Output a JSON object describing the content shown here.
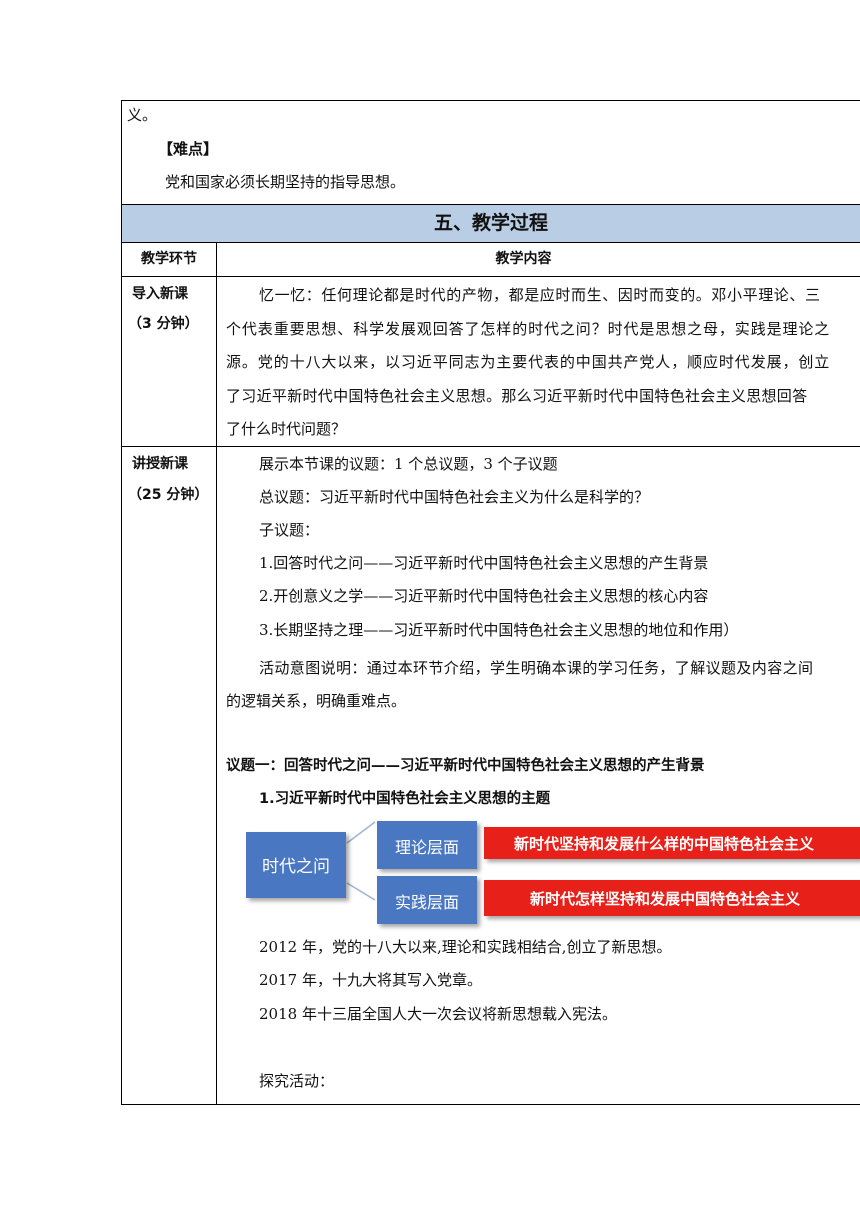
{
  "top": {
    "line1": "义。",
    "difficulty_heading": "【难点】",
    "difficulty_text": "党和国家必须长期坚持的指导思想。"
  },
  "section": {
    "title": "五、教学过程"
  },
  "table_header": {
    "col1": "教学环节",
    "col2": "教学内容"
  },
  "intro": {
    "stage": "导入新课",
    "duration": "（3 分钟）",
    "lines": [
      "忆一忆：任何理论都是时代的产物，都是应时而生、因时而变的。邓小平理论、三",
      "个代表重要思想、科学发展观回答了怎样的时代之问？时代是思想之母，实践是理论之",
      "源。党的十八大以来，以习近平同志为主要代表的中国共产党人，顺应时代发展，创立",
      "了习近平新时代中国特色社会主义思想。那么习近平新时代中国特色社会主义思想回答",
      "了什么时代问题？"
    ]
  },
  "lecture": {
    "stage": "讲授新课",
    "duration": "（25 分钟）",
    "lines": [
      "展示本节课的议题：1 个总议题，3 个子议题",
      "总议题：习近平新时代中国特色社会主义为什么是科学的？",
      "子议题：",
      "1.回答时代之问——习近平新时代中国特色社会主义思想的产生背景",
      "2.开创意义之学——习近平新时代中国特色社会主义思想的核心内容",
      "3.长期坚持之理——习近平新时代中国特色社会主义思想的地位和作用）",
      "活动意图说明：通过本环节介绍，学生明确本课的学习任务，了解议题及内容之间",
      "的逻辑关系，明确重难点。"
    ],
    "topic1_title": "议题一：回答时代之问——习近平新时代中国特色社会主义思想的产生背景",
    "subheading": "1.习近平新时代中国特色社会主义思想的主题",
    "diagram": {
      "center": "时代之问",
      "upper_label": "理论层面",
      "upper_text": "新时代坚持和发展什么样的中国特色社会主义",
      "lower_label": "实践层面",
      "lower_text": "新时代怎样坚持和发展中国特色社会主义"
    },
    "facts": [
      "2012 年，党的十八大以来,理论和实践相结合,创立了新思想。",
      "2017 年，十九大将其写入党章。",
      "2018 年十三届全国人大一次会议将新思想载入宪法。"
    ],
    "activity": "探究活动："
  }
}
